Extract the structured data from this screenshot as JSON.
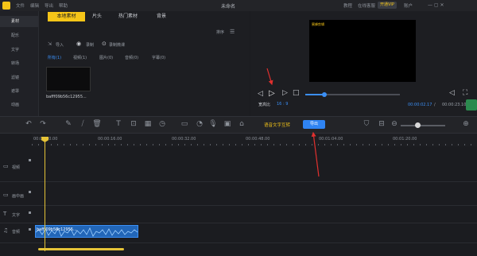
{
  "titlebar": {
    "menus": [
      "文件",
      "编辑",
      "导出",
      "帮助"
    ],
    "title": "未命名",
    "right": [
      "教程",
      "在线客服"
    ],
    "vip": "开通VIP",
    "account": "账户",
    "autosave": "最近保存 09:52"
  },
  "leftnav": {
    "items": [
      {
        "label": "素材"
      },
      {
        "label": "配乐"
      },
      {
        "label": "文字"
      },
      {
        "label": "转场"
      },
      {
        "label": "滤镜"
      },
      {
        "label": "遮罩"
      },
      {
        "label": "动画"
      }
    ]
  },
  "library": {
    "tabs": [
      "本地素材",
      "片头",
      "热门素材",
      "背景"
    ],
    "sort": "排序",
    "actions": [
      "导入",
      "录制",
      "录制微课"
    ],
    "filters": [
      "所有(1)",
      "视频(1)",
      "图片(0)",
      "音频(0)",
      "字幕(0)"
    ],
    "thumb_name": "bafff09b56c12955..."
  },
  "preview": {
    "screen_text": "蜜蜂剪辑",
    "ratio_label": "宽高比",
    "ratio_value": "16 : 9",
    "current_time": "00:00:02.17",
    "total_time": "00:00:23.10",
    "progress": 0.2
  },
  "toolbar": {
    "speech_to_text": "语音文字互转",
    "export": "导出"
  },
  "timeline": {
    "ticks": [
      "00:00:00.00",
      "00:00:16.00",
      "00:00:32.00",
      "00:00:48.00",
      "00:01:04.00",
      "00:01:20.00"
    ],
    "tracks": [
      "视频",
      "画中画",
      "文字",
      "音频"
    ],
    "audio_clip": "bafff09b56c12955..."
  },
  "colors": {
    "accent": "#f5c518",
    "export_blue": "#2f84f3",
    "annotation_red": "#e0302e",
    "playhead": "#e5c337"
  }
}
